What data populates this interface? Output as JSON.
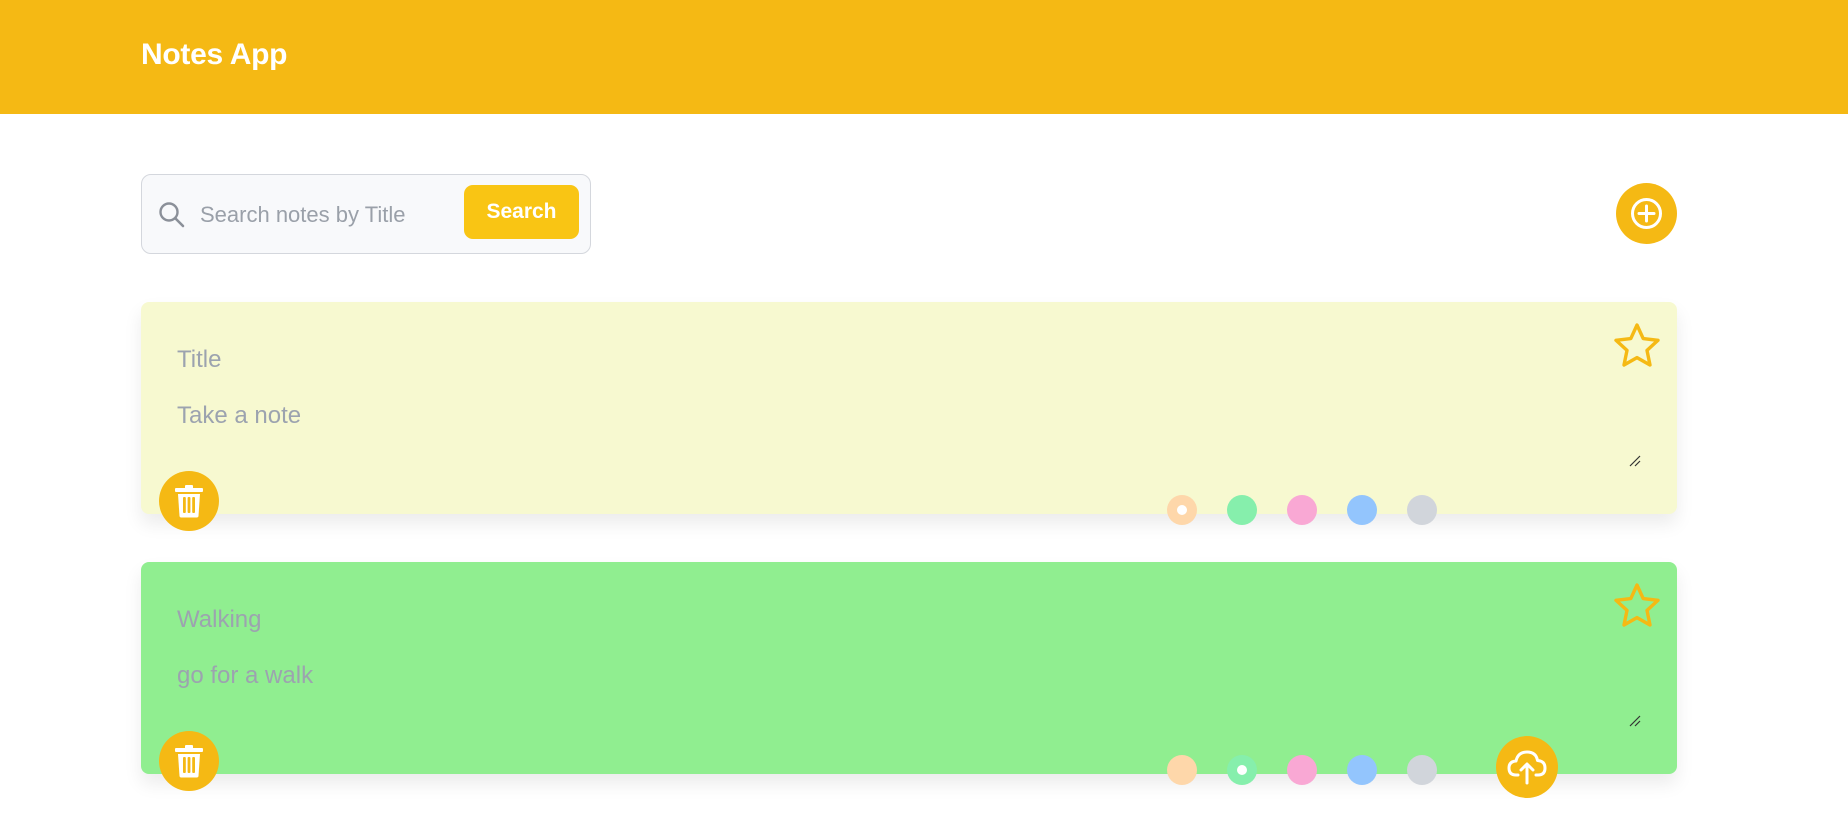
{
  "header": {
    "title": "Notes App"
  },
  "search": {
    "placeholder": "Search notes by Title",
    "value": "",
    "button_label": "Search"
  },
  "colors": {
    "accent": "#f5b914",
    "swatches": [
      "#fed7aa",
      "#86efac",
      "#f9a8d4",
      "#93c5fd",
      "#d1d5db"
    ]
  },
  "notes": [
    {
      "title": "",
      "title_placeholder": "Title",
      "body": "",
      "body_placeholder": "Take a note",
      "background": "#f7f9d0",
      "selected_color": 0,
      "starred": false,
      "show_upload": false
    },
    {
      "title": "Walking",
      "title_placeholder": "Title",
      "body": "go for a walk",
      "body_placeholder": "Take a note",
      "background": "#90ee90",
      "selected_color": 1,
      "starred": false,
      "show_upload": true
    }
  ],
  "icons": {
    "search": "search-icon",
    "add": "plus-circle-icon",
    "star": "star-icon",
    "delete": "trash-icon",
    "upload": "cloud-upload-icon",
    "resize": "resize-grip-icon"
  }
}
